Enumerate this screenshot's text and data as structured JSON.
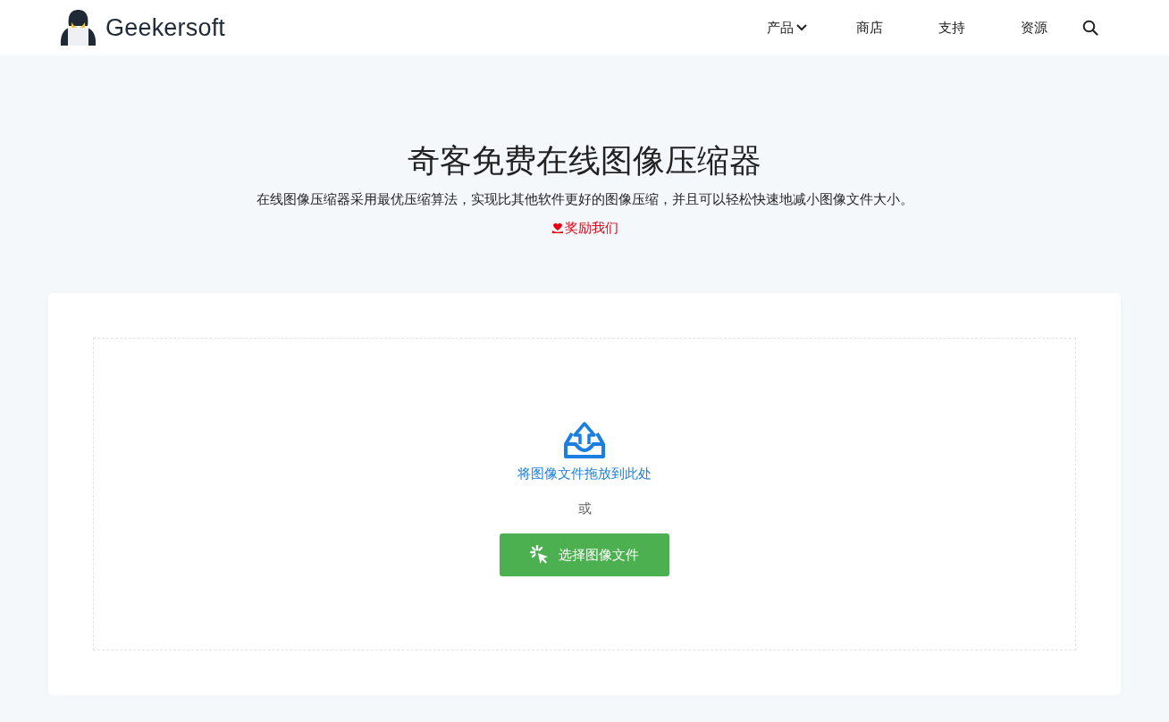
{
  "header": {
    "logo_text": "Geekersoft",
    "nav": [
      {
        "label": "产品",
        "kind": "dropdown"
      },
      {
        "label": "商店",
        "kind": "link"
      },
      {
        "label": "支持",
        "kind": "link"
      },
      {
        "label": "资源",
        "kind": "link"
      }
    ]
  },
  "hero": {
    "title": "奇客免费在线图像压缩器",
    "subtitle": "在线图像压缩器采用最优压缩算法，实现比其他软件更好的图像压缩，并且可以轻松快速地减小图像文件大小。",
    "donate": "奖励我们"
  },
  "upload": {
    "drop_text": "将图像文件拖放到此处",
    "or_text": "或",
    "button": "选择图像文件"
  }
}
